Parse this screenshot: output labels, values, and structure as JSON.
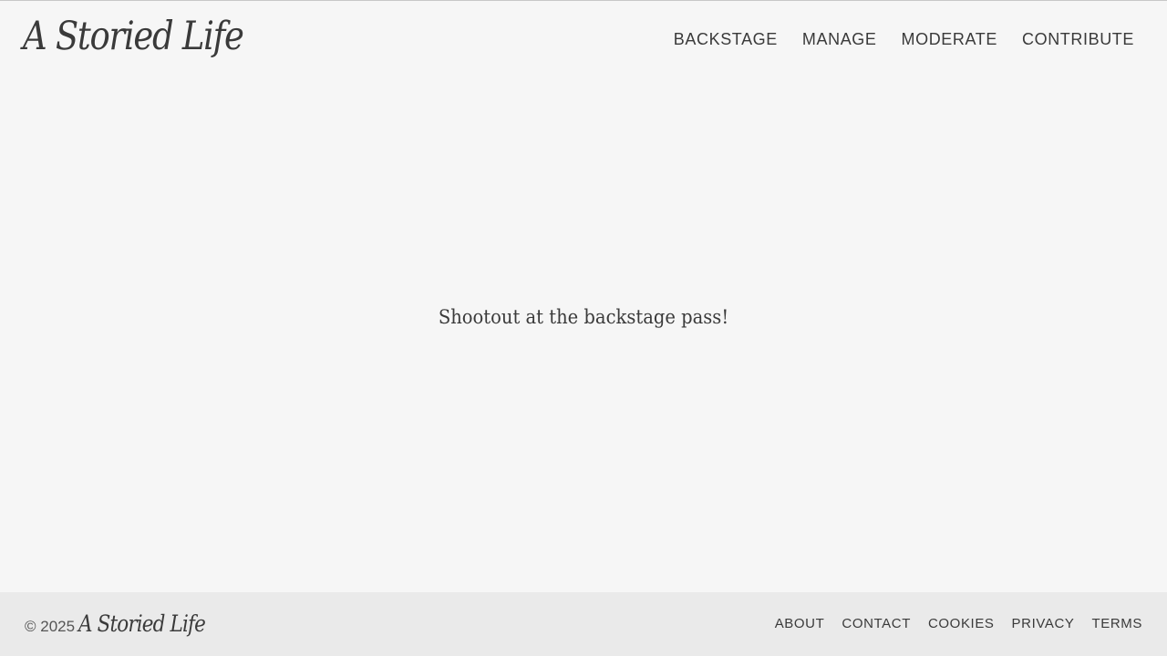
{
  "header": {
    "logo_text": "A Storied Life",
    "nav": [
      {
        "label": "BACKSTAGE"
      },
      {
        "label": "MANAGE"
      },
      {
        "label": "MODERATE"
      },
      {
        "label": "CONTRIBUTE"
      }
    ]
  },
  "main": {
    "message": "Shootout at the backstage pass!"
  },
  "footer": {
    "copyright": "© 2025",
    "logo_text": "A Storied Life",
    "links": [
      {
        "label": "ABOUT"
      },
      {
        "label": "CONTACT"
      },
      {
        "label": "COOKIES"
      },
      {
        "label": "PRIVACY"
      },
      {
        "label": "TERMS"
      }
    ]
  },
  "colors": {
    "background": "#f6f6f6",
    "footer_background": "#eaeaea",
    "text": "#3a3a3a"
  }
}
